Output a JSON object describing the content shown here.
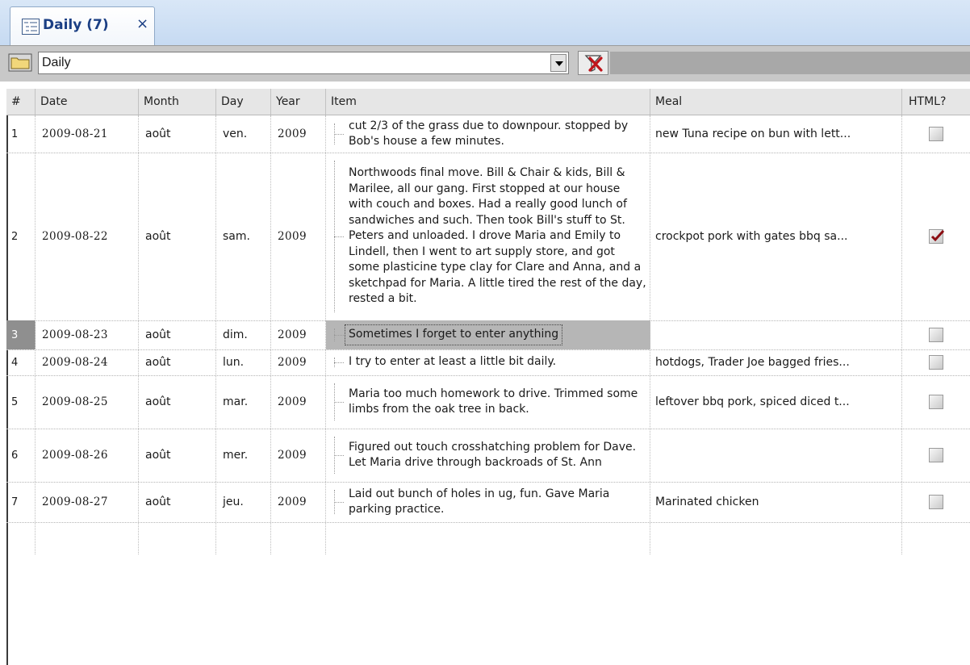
{
  "tab": {
    "label": "Daily (7)",
    "close": "×",
    "icon": "outline-list-icon"
  },
  "toolbar": {
    "view_value": "Daily",
    "folder_icon": "folder-icon",
    "filter_icon": "clear-filter-icon"
  },
  "grid": {
    "columns": [
      "#",
      "Date",
      "Month",
      "Day",
      "Year",
      "Item",
      "Meal",
      "HTML?"
    ],
    "rows": [
      {
        "num": "1",
        "date": "2009-08-21",
        "month": "août",
        "day": "ven.",
        "year": "2009",
        "item": "cut 2/3 of the grass due to downpour. stopped by Bob's house a few minutes.",
        "meal": "new Tuna recipe on bun with lett...",
        "html": false
      },
      {
        "num": "2",
        "date": "2009-08-22",
        "month": "août",
        "day": "sam.",
        "year": "2009",
        "item": "Northwoods final move. Bill & Chair & kids, Bill & Marilee, all our gang.  First stopped at our house with couch and boxes. Had a really good lunch of sandwiches and such. Then took Bill's stuff to St. Peters and unloaded. I drove Maria and Emily to Lindell, then I went to art supply store, and got some plasticine type clay for Clare and Anna, and a sketchpad for Maria. A little tired the rest of the day, rested a bit.",
        "meal": "crockpot pork with gates bbq sa...",
        "html": true
      },
      {
        "num": "3",
        "date": "2009-08-23",
        "month": "août",
        "day": "dim.",
        "year": "2009",
        "item": "Sometimes I forget to enter anything",
        "meal": "",
        "html": false,
        "selected": true
      },
      {
        "num": "4",
        "date": "2009-08-24",
        "month": "août",
        "day": "lun.",
        "year": "2009",
        "item": "I try to enter at least a little bit daily.",
        "meal": "hotdogs, Trader Joe bagged fries...",
        "html": false
      },
      {
        "num": "5",
        "date": "2009-08-25",
        "month": "août",
        "day": "mar.",
        "year": "2009",
        "item": "Maria too much homework to drive. Trimmed some limbs from the oak tree in back.",
        "meal": "leftover bbq pork, spiced diced t...",
        "html": false
      },
      {
        "num": "6",
        "date": "2009-08-26",
        "month": "août",
        "day": "mer.",
        "year": "2009",
        "item": "Figured out touch crosshatching problem for Dave. Let Maria drive through backroads of St. Ann",
        "meal": "",
        "html": false
      },
      {
        "num": "7",
        "date": "2009-08-27",
        "month": "août",
        "day": "jeu.",
        "year": "2009",
        "item": "Laid out bunch of holes in ug, fun. Gave Maria parking practice.",
        "meal": "Marinated chicken",
        "html": false
      }
    ]
  }
}
